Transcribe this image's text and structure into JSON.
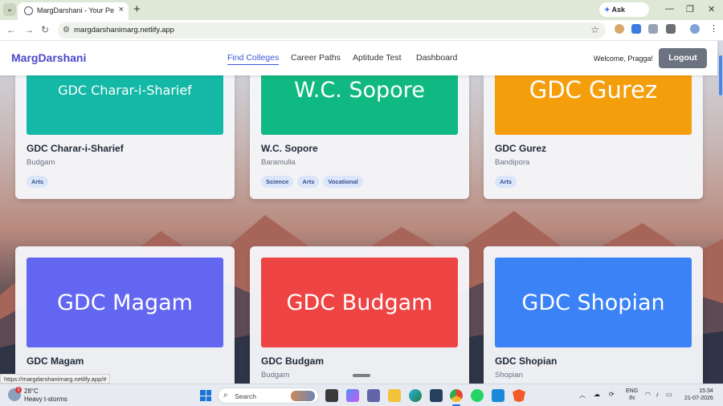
{
  "browser": {
    "tab_title": "MargDarshani - Your Personaliz...",
    "tab_close": "×",
    "new_tab": "+",
    "gemini_label": "Ask Gemini",
    "url": "margdarshanimarg.netlify.app",
    "minimize": "—",
    "maximize": "❐",
    "close": "✕"
  },
  "site": {
    "brand": "MargDarshani",
    "nav": [
      "Find Colleges",
      "Career Paths",
      "Aptitude Test",
      "Dashboard"
    ],
    "active_nav": "Find Colleges",
    "welcome": "Welcome, Pragga!",
    "logout": "Logout"
  },
  "colleges": [
    {
      "banner": "GDC Charar-i-Sharief",
      "name": "GDC Charar-i-Sharief",
      "location": "Budgam",
      "tags": [
        "Arts"
      ],
      "color": "#14b8a6"
    },
    {
      "banner": "W.C. Sopore",
      "name": "W.C. Sopore",
      "location": "Baramulla",
      "tags": [
        "Science",
        "Arts",
        "Vocational"
      ],
      "color": "#10b981"
    },
    {
      "banner": "GDC Gurez",
      "name": "GDC Gurez",
      "location": "Bandipora",
      "tags": [
        "Arts"
      ],
      "color": "#f59e0b"
    },
    {
      "banner": "GDC Magam",
      "name": "GDC Magam",
      "location": "",
      "tags": [],
      "color": "#6366f1"
    },
    {
      "banner": "GDC Budgam",
      "name": "GDC Budgam",
      "location": "Budgam",
      "tags": [],
      "color": "#ef4444"
    },
    {
      "banner": "GDC Shopian",
      "name": "GDC Shopian",
      "location": "Shopian",
      "tags": [],
      "color": "#3b82f6"
    }
  ],
  "status_url": "https://margdarshanimarg.netlify.app/#",
  "taskbar": {
    "weather_temp": "28°C",
    "weather_desc": "Heavy t-storms",
    "weather_badge": "1",
    "search_placeholder": "Search",
    "lang_line1": "ENG",
    "lang_line2": "IN",
    "time": "15:34",
    "date": "21-07-2026"
  }
}
